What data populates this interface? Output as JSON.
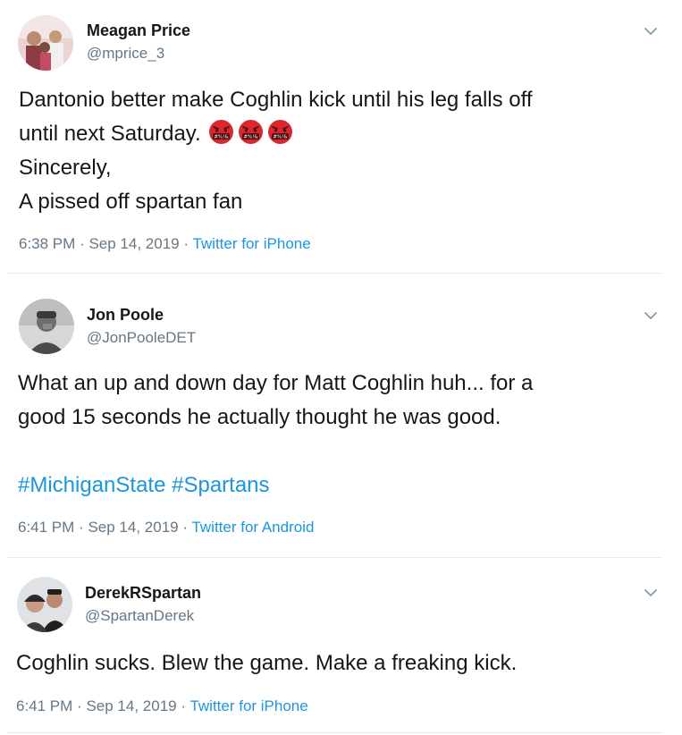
{
  "tweets": [
    {
      "name": "Meagan Price",
      "handle": "@mprice_3",
      "lines": [
        "Dantonio better make Coghlin kick until his leg falls off",
        "until next Saturday.",
        "Sincerely,",
        "A pissed off spartan fan"
      ],
      "emojis": [
        "face-with-symbols-on-mouth-icon",
        "face-with-symbols-on-mouth-icon",
        "face-with-symbols-on-mouth-icon"
      ],
      "time": "6:38 PM",
      "date": "Sep 14, 2019",
      "source": "Twitter for iPhone"
    },
    {
      "name": "Jon Poole",
      "handle": "@JonPooleDET",
      "lines": [
        "What an up and down day for Matt Coghlin huh... for a",
        "good 15 seconds he actually thought he was good."
      ],
      "hashtags": [
        "#MichiganState",
        "#Spartans"
      ],
      "time": "6:41 PM",
      "date": "Sep 14, 2019",
      "source": "Twitter for Android"
    },
    {
      "name": "DerekRSpartan",
      "handle": "@SpartanDerek",
      "lines": [
        "Coghlin sucks. Blew the game. Make a freaking kick."
      ],
      "time": "6:41 PM",
      "date": "Sep 14, 2019",
      "source": "Twitter for iPhone"
    }
  ],
  "meta_separator": "·",
  "colors": {
    "text": "#14171a",
    "secondary": "#657786",
    "link": "#1b95e0",
    "divider": "#e6ecf0"
  }
}
